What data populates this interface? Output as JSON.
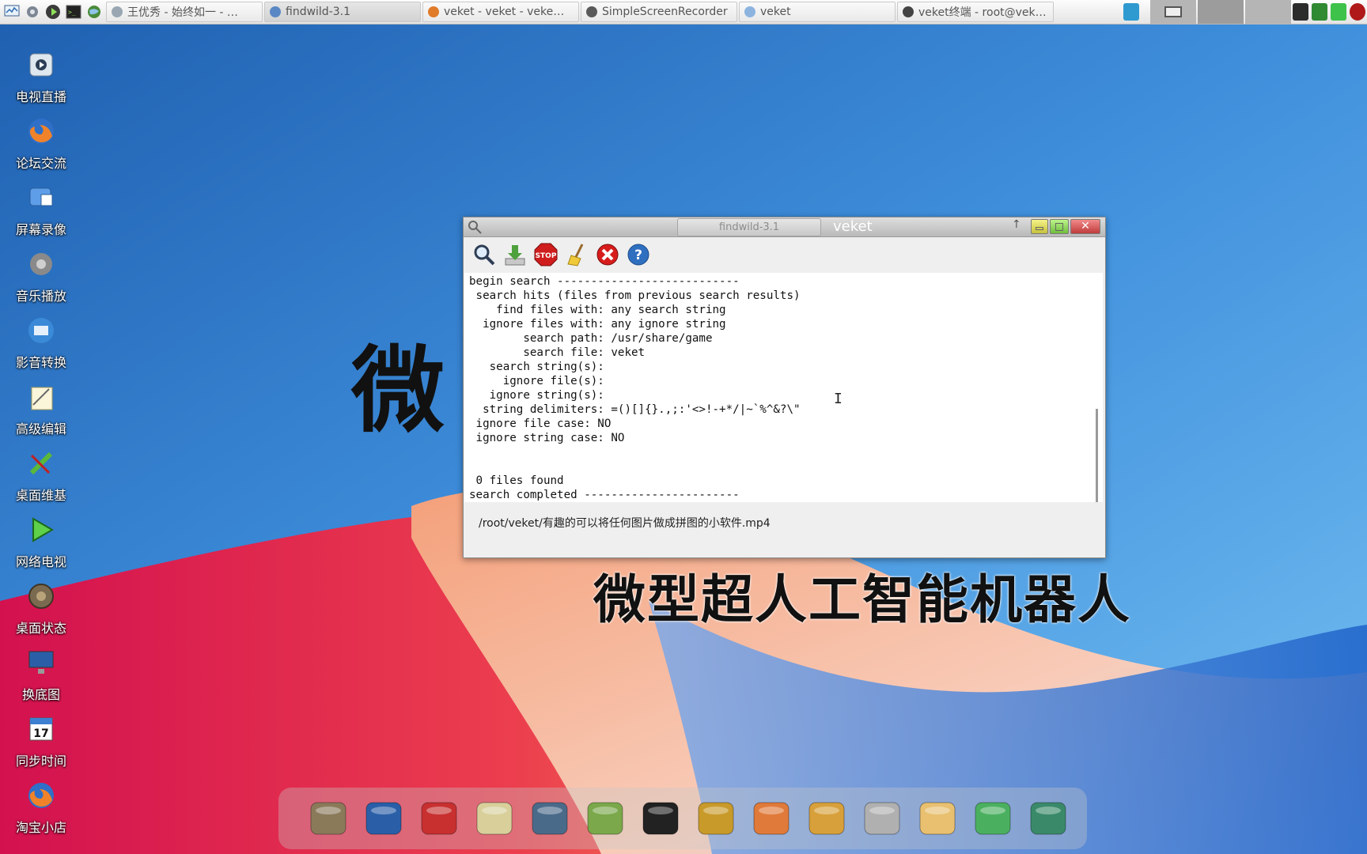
{
  "taskbar": {
    "quick_icons": [
      "monitor-icon",
      "tools-icon",
      "play-icon",
      "terminal-icon",
      "globe-icon"
    ],
    "tasks": [
      {
        "label": "王优秀 - 始终如一 - …",
        "icon": "app-icon",
        "active": false
      },
      {
        "label": "findwild-3.1",
        "icon": "search-icon",
        "active": true
      },
      {
        "label": "veket - veket - veke…",
        "icon": "browser-icon",
        "active": false
      },
      {
        "label": "SimpleScreenRecorder",
        "icon": "recorder-icon",
        "active": false
      },
      {
        "label": "veket",
        "icon": "folder-icon",
        "active": false
      },
      {
        "label": "veket终端 - root@vek…",
        "icon": "terminal-icon",
        "active": false
      }
    ],
    "tray_icons": [
      "network-icon",
      "play-icon",
      "signal-icon",
      "battery-icon",
      "record-icon"
    ]
  },
  "desktop_icons": [
    {
      "label": "电视直播",
      "icon": "tv-icon"
    },
    {
      "label": "论坛交流",
      "icon": "firefox-icon"
    },
    {
      "label": "屏幕录像",
      "icon": "screen-record-icon"
    },
    {
      "label": "音乐播放",
      "icon": "speaker-icon"
    },
    {
      "label": "影音转换",
      "icon": "media-convert-icon"
    },
    {
      "label": "高级编辑",
      "icon": "editor-icon"
    },
    {
      "label": "桌面维基",
      "icon": "wiki-icon"
    },
    {
      "label": "网络电视",
      "icon": "play-icon"
    },
    {
      "label": "桌面状态",
      "icon": "status-icon"
    },
    {
      "label": "换底图",
      "icon": "wallpaper-icon"
    },
    {
      "label": "同步时间",
      "icon": "calendar-icon"
    },
    {
      "label": "淘宝小店",
      "icon": "firefox-icon"
    }
  ],
  "overlay": {
    "big_char": "微",
    "subtitle": "微型超人工智能机器人"
  },
  "window": {
    "tab_label": "findwild-3.1",
    "app_label": "veket",
    "toolbar": [
      {
        "name": "search-icon",
        "title": "search"
      },
      {
        "name": "download-icon",
        "title": "download"
      },
      {
        "name": "stop-icon",
        "title": "STOP"
      },
      {
        "name": "broom-icon",
        "title": "clear"
      },
      {
        "name": "close-circle-icon",
        "title": "close"
      },
      {
        "name": "help-icon",
        "title": "help"
      }
    ],
    "stop_label": "STOP",
    "close_glyph": "✕",
    "output_lines": [
      "begin search ---------------------------",
      " search hits (files from previous search results)",
      "    find files with: any search string",
      "  ignore files with: any ignore string",
      "        search path: /usr/share/game",
      "        search file: veket",
      "   search string(s):",
      "     ignore file(s):",
      "   ignore string(s):",
      "  string delimiters: =()[]{}.,;:'<>!-+*/|~`%^&?\\\"",
      " ignore file case: NO",
      " ignore string case: NO",
      "",
      "",
      " 0 files found",
      "search completed -----------------------"
    ],
    "status_path": "/root/veket/有趣的可以将任何图片做成拼图的小软件.mp4"
  },
  "dock": [
    "shell-icon",
    "computer-icon",
    "hedgehog-icon",
    "notepad-icon",
    "media-player-icon",
    "chat-users-icon",
    "penguin-icon",
    "contacts-icon",
    "presentation-icon",
    "paint-icon",
    "usb-icon",
    "photo-icon",
    "question-icon",
    "camera-icon"
  ],
  "colors": {
    "wallpaper_blue": "#3d8ad6",
    "wallpaper_red": "#e8245a",
    "wallpaper_orange": "#f28a5a",
    "wallpaper_peach": "#f7c4ae"
  }
}
